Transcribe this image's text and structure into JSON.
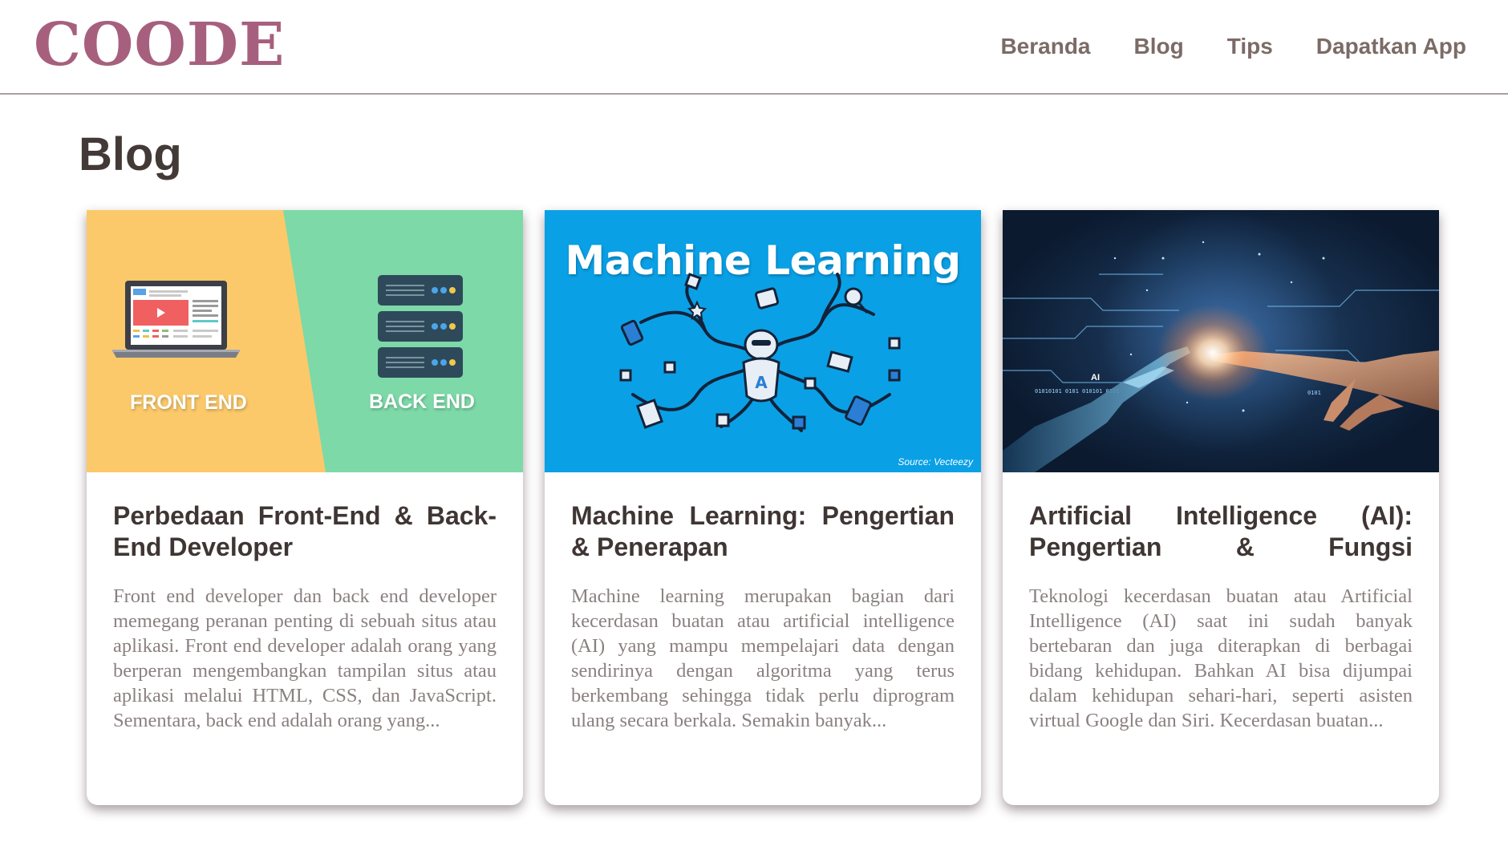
{
  "brand": {
    "logo": "COODE",
    "color": "#a6607e"
  },
  "nav": {
    "items": [
      {
        "label": "Beranda"
      },
      {
        "label": "Blog"
      },
      {
        "label": "Tips"
      },
      {
        "label": "Dapatkan App"
      }
    ]
  },
  "page": {
    "title": "Blog"
  },
  "cards": [
    {
      "image": {
        "label_left": "FRONT END",
        "label_right": "BACK END"
      },
      "title": "Perbedaan Front-End & Back-End Developer",
      "excerpt": "Front end developer dan back end developer memegang peranan penting di sebuah situs atau aplikasi. Front end developer adalah orang yang berperan mengembangkan tampilan situs atau aplikasi melalui HTML, CSS, dan JavaScript. Sementara, back end adalah orang yang..."
    },
    {
      "image": {
        "heading": "Machine Learning",
        "source": "Source: Vecteezy"
      },
      "title": "Machine Learning: Pengertian & Penerapan",
      "excerpt": "Machine learning merupakan bagian dari kecerdasan buatan atau artificial intelligence (AI) yang mampu mempelajari data dengan sendirinya dengan algoritma yang terus berkembang sehingga tidak perlu diprogram ulang secara berkala. Semakin banyak..."
    },
    {
      "image": {
        "chip_label": "AI"
      },
      "title": "Artificial Intelligence (AI): Pengertian & Fungsi",
      "excerpt": "Teknologi kecerdasan buatan atau Artificial Intelligence (AI) saat ini sudah banyak bertebaran dan juga diterapkan di berbagai bidang kehidupan. Bahkan AI bisa dijumpai dalam kehidupan sehari-hari, seperti asisten virtual Google dan Siri. Kecerdasan buatan..."
    }
  ]
}
